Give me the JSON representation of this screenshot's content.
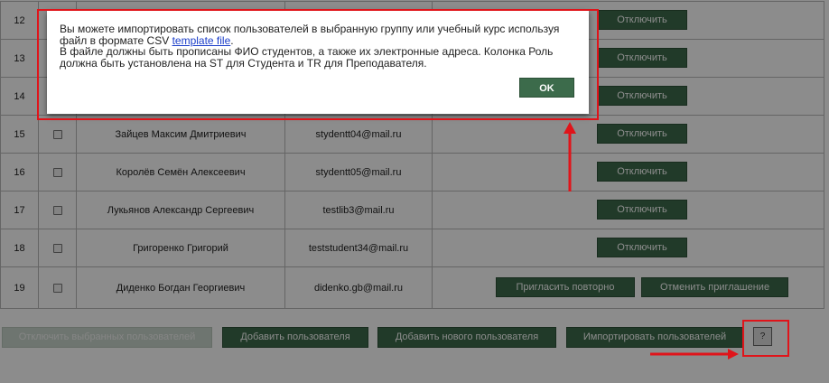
{
  "rows": [
    {
      "num": "12",
      "name": "",
      "email": "",
      "actions": [
        "Отключить"
      ]
    },
    {
      "num": "13",
      "name": "",
      "email": "",
      "actions": [
        "Отключить"
      ]
    },
    {
      "num": "14",
      "name": "",
      "email": "",
      "actions": [
        "Отключить"
      ]
    },
    {
      "num": "15",
      "name": "Зайцев Максим Дмитриевич",
      "email": "stydentt04@mail.ru",
      "actions": [
        "Отключить"
      ]
    },
    {
      "num": "16",
      "name": "Королёв Семён Алексеевич",
      "email": "stydentt05@mail.ru",
      "actions": [
        "Отключить"
      ]
    },
    {
      "num": "17",
      "name": "Лукьянов Александр Сергеевич",
      "email": "testlib3@mail.ru",
      "actions": [
        "Отключить"
      ]
    },
    {
      "num": "18",
      "name": "Григоренко Григорий",
      "email": "teststudent34@mail.ru",
      "actions": [
        "Отключить"
      ]
    },
    {
      "num": "19",
      "name": "Диденко Богдан Георгиевич",
      "email": "didenko.gb@mail.ru",
      "actions": [
        "Пригласить повторно",
        "Отменить приглашение"
      ]
    }
  ],
  "bottom": {
    "disable_selected": "Отключить выбранных пользователей",
    "add_user": "Добавить пользователя",
    "add_new_user": "Добавить нового пользователя",
    "import_users": "Импортировать пользователей",
    "help": "?"
  },
  "modal": {
    "line1": "Вы можете импортировать список пользователей в выбранную группу или учебный курс используя",
    "line2_prefix": "файл в формате CSV ",
    "link": "template file",
    "line2_suffix": ".",
    "line3": "В файле должны быть прописаны ФИО студентов, а также их электронные адреса. Колонка Роль",
    "line4": "должна быть установлена на ST для Студента и TR для Преподавателя.",
    "ok": "OK"
  },
  "colors": {
    "button": "#3c6b4b",
    "highlight": "#e0141a"
  }
}
